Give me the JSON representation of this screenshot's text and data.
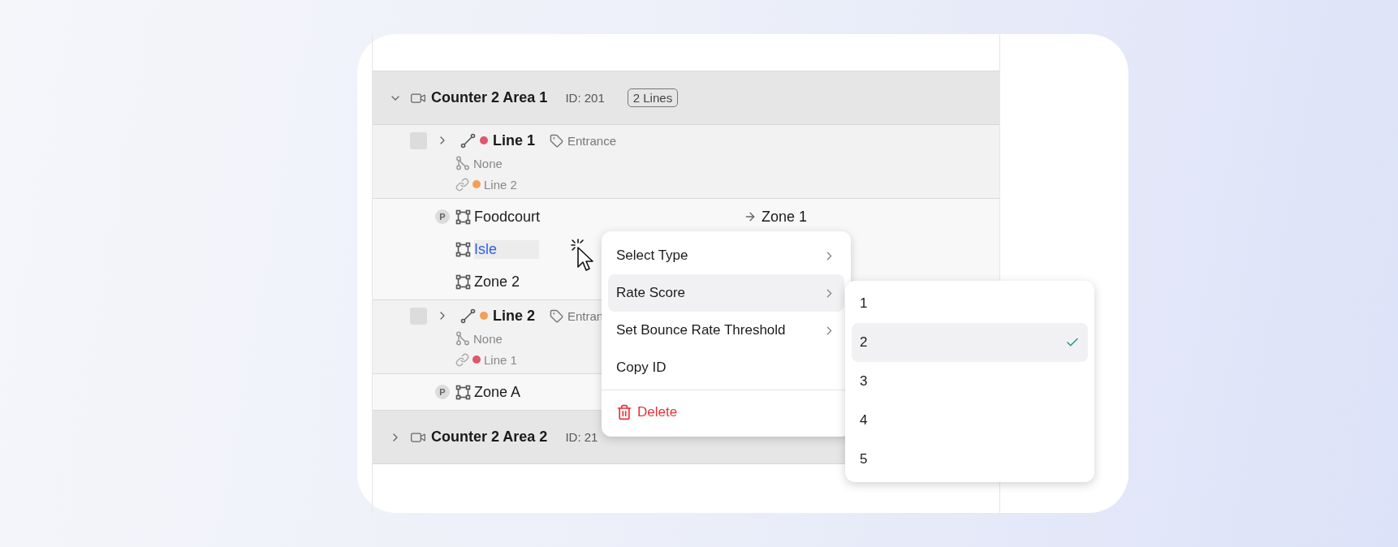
{
  "groups": [
    {
      "name": "Counter 2 Area 1",
      "id_label": "ID: 201",
      "badge": "2 Lines",
      "expanded": true,
      "children": [
        {
          "kind": "line",
          "name": "Line 1",
          "color": "#e0566c",
          "tag": "Entrance",
          "branch": "None",
          "link": {
            "name": "Line 2",
            "color": "#f59e55"
          },
          "checked": false,
          "expanded": false
        },
        {
          "kind": "zones",
          "items": [
            {
              "badge": "P",
              "name": "Foodcourt",
              "target": "Zone 1",
              "selected": false
            },
            {
              "name": "Isle",
              "selected": true
            },
            {
              "name": "Zone 2",
              "selected": false
            }
          ]
        },
        {
          "kind": "line",
          "name": "Line 2",
          "color": "#f59e55",
          "tag": "Entran",
          "branch": "None",
          "link": {
            "name": "Line 1",
            "color": "#e0566c"
          },
          "checked": false,
          "expanded": false
        },
        {
          "kind": "zones",
          "items": [
            {
              "badge": "P",
              "name": "Zone A",
              "selected": false
            }
          ]
        }
      ]
    },
    {
      "name": "Counter 2 Area 2",
      "id_label": "ID: 21",
      "expanded": false
    }
  ],
  "context_menu": {
    "items": [
      {
        "kind": "item",
        "label": "Select Type",
        "submenu": true,
        "selected": false
      },
      {
        "kind": "item",
        "label": "Rate Score",
        "submenu": true,
        "selected": true
      },
      {
        "kind": "item",
        "label": "Set Bounce Rate Threshold",
        "submenu": true,
        "selected": false
      },
      {
        "kind": "item",
        "label": "Copy ID",
        "submenu": false,
        "selected": false
      },
      {
        "kind": "divider"
      },
      {
        "kind": "danger",
        "label": "Delete",
        "submenu": false,
        "selected": false
      }
    ]
  },
  "submenu": {
    "options": [
      {
        "label": "1",
        "selected": false
      },
      {
        "label": "2",
        "selected": true
      },
      {
        "label": "3",
        "selected": false
      },
      {
        "label": "4",
        "selected": false
      },
      {
        "label": "5",
        "selected": false
      }
    ]
  }
}
